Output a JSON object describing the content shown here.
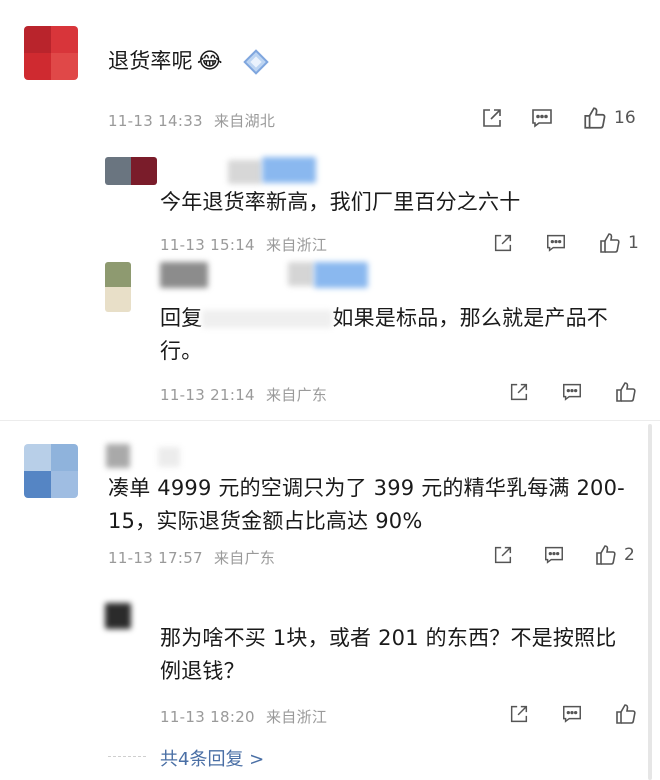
{
  "thread": {
    "comments": [
      {
        "text": "退货率呢",
        "emoji": "😂",
        "time": "11-13 14:33",
        "location": "来自湖北",
        "likes": "16",
        "replies": [
          {
            "text": "今年退货率新高，我们厂里百分之六十",
            "time": "11-13 15:14",
            "location": "来自浙江",
            "likes": "1"
          },
          {
            "reply_prefix": "回复",
            "text": "如果是标品，那么就是产品不行。",
            "time": "11-13 21:14",
            "location": "来自广东",
            "likes": ""
          }
        ]
      },
      {
        "text": "凑单 4999 元的空调只为了 399 元的精华乳每满 200-15，实际退货金额占比高达 90%",
        "time": "11-13 17:57",
        "location": "来自广东",
        "likes": "2",
        "replies": [
          {
            "text": "那为啥不买 1块，或者 201 的东西？不是按照比例退钱？",
            "time": "11-13 18:20",
            "location": "来自浙江",
            "likes": ""
          }
        ],
        "more_replies": "共4条回复 >"
      }
    ]
  },
  "icons": {
    "share": "share-icon",
    "comment": "comment-icon",
    "like": "thumb-up-icon"
  },
  "colors": {
    "text": "#1a1a1a",
    "meta": "#9a9a9a",
    "link": "#4a6fa5",
    "icon": "#555555"
  }
}
